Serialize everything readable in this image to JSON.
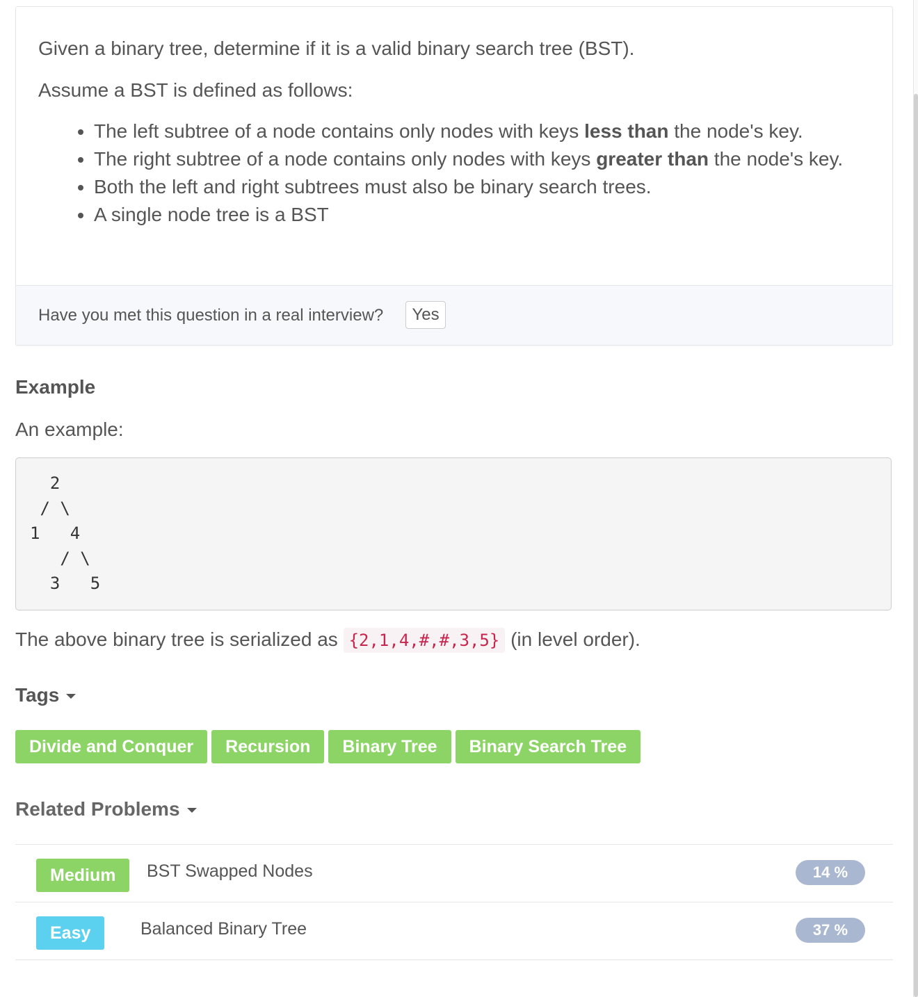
{
  "description": {
    "intro": "Given a binary tree, determine if it is a valid binary search tree (BST).",
    "assume": "Assume a BST is defined as follows:",
    "rules": [
      {
        "before": "The left subtree of a node contains only nodes with keys ",
        "bold": "less than",
        "after": " the node's key."
      },
      {
        "before": "The right subtree of a node contains only nodes with keys ",
        "bold": "greater than",
        "after": " the node's key."
      },
      {
        "text": "Both the left and right subtrees must also be binary search trees."
      },
      {
        "text": "A single node tree is a BST"
      }
    ]
  },
  "interview": {
    "question": "Have you met this question in a real interview?",
    "yes_label": "Yes"
  },
  "example": {
    "heading": "Example",
    "intro": "An example:",
    "tree_ascii": "  2\n / \\\n1   4\n   / \\\n  3   5",
    "serial_before": "The above binary tree is serialized as ",
    "serial_code": "{2,1,4,#,#,3,5}",
    "serial_after": " (in level order)."
  },
  "tags": {
    "heading": "Tags",
    "color": "#8cd466",
    "items": [
      "Divide and Conquer",
      "Recursion",
      "Binary Tree",
      "Binary Search Tree"
    ]
  },
  "related": {
    "heading": "Related Problems",
    "items": [
      {
        "difficulty": "Medium",
        "difficulty_color": "#8cd466",
        "title": "BST Swapped Nodes",
        "rate": "14 %",
        "rate_color": "#a9b7d0"
      },
      {
        "difficulty": "Easy",
        "difficulty_color": "#5bd0ef",
        "title": "Balanced Binary Tree",
        "rate": "37 %",
        "rate_color": "#a9b7d0"
      }
    ]
  }
}
